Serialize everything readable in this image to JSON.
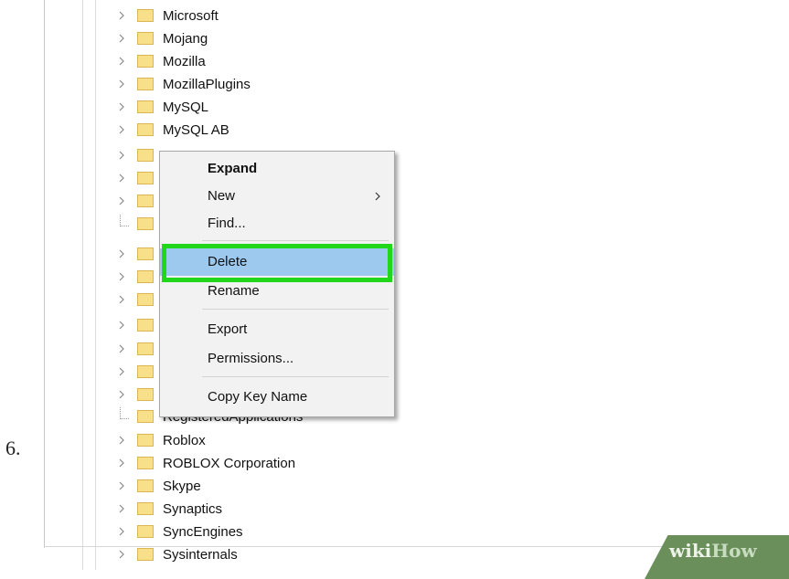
{
  "step_number": "6.",
  "tree": {
    "top_items": [
      "Microsoft",
      "Mojang",
      "Mozilla",
      "MozillaPlugins",
      "MySQL",
      "MySQL AB"
    ],
    "partial_item": "RegisteredApplications",
    "bottom_items": [
      "Roblox",
      "ROBLOX Corporation",
      "Skype",
      "Synaptics",
      "SyncEngines",
      "Sysinternals"
    ]
  },
  "context_menu": {
    "expand": "Expand",
    "new": "New",
    "find": "Find...",
    "delete": "Delete",
    "rename": "Rename",
    "export": "Export",
    "permissions": "Permissions...",
    "copy_key_name": "Copy Key Name"
  },
  "watermark": {
    "wiki": "wiki",
    "how": "How"
  },
  "colors": {
    "menu_highlight": "#9ec9ef",
    "highlight_outline": "#22d61b",
    "folder_fill": "#f8df8a",
    "folder_edge": "#d9b650"
  }
}
